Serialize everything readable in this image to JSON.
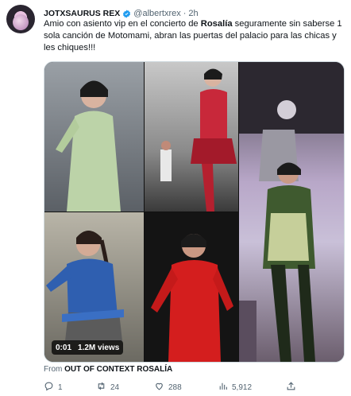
{
  "tweet": {
    "display_name": "JOTXSAURUS REX",
    "handle": "@albertxrex",
    "separator": "·",
    "time": "2h",
    "text_part1": "Amio con asiento vip en el concierto de ",
    "text_bold": "Rosalía",
    "text_part2": " seguramente sin saberse 1 sola canción de Motomami, abran las puertas del palacio para las chicas y les chiques!!!",
    "media": {
      "time_label": "0:01",
      "views_label": "1.2M views"
    },
    "from_prefix": "From",
    "from_source": "OUT OF CONTEXT ROSALÍA",
    "actions": {
      "replies": "1",
      "retweets": "24",
      "likes": "288",
      "views": "5,912"
    }
  },
  "colors": {
    "text": "#0f1419",
    "secondary": "#536471",
    "verified": "#1d9bf0"
  },
  "icons": [
    "avatar",
    "verified-icon",
    "reply-icon",
    "retweet-icon",
    "like-icon",
    "views-icon",
    "share-icon"
  ]
}
